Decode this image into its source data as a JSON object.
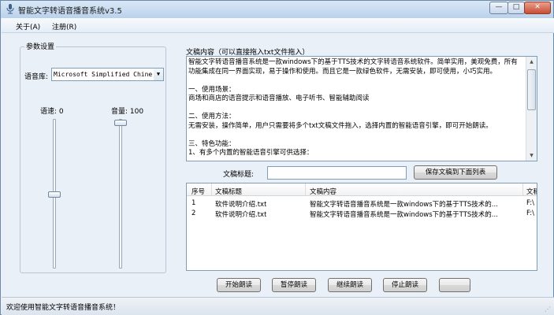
{
  "window": {
    "title": "智能文字转语音播音系统v3.5",
    "min_glyph": "—",
    "max_glyph": "□",
    "close_glyph": "✕"
  },
  "menu": {
    "about": "关于(A)",
    "register": "注册(R)"
  },
  "params": {
    "group_label": "参数设置",
    "voice_label": "语音库:",
    "voice_value": "Microsoft Simplified Chine",
    "rate_label": "语速: 0",
    "volume_label": "音量: 100",
    "rate_value": 0,
    "volume_value": 100
  },
  "content": {
    "label": "文稿内容（可以直接拖入txt文件拖入）",
    "text": "智能文字转语音播音系统是一款windows下的基于TTS技术的文字转语音系统软件。简单实用，美观免费，所有功能集成在同一界面实现，易于操作和使用。而且它是一款绿色软件，无需安装，即可使用，小巧实用。\n\n一、使用场景：\n商场和商店的语音提示和语音播放、电子听书、智能辅助阅读\n\n二、使用方法：\n无需安装，操作简单，用户只需要将多个txt文稿文件拖入，选择内置的智能语音引擎，即可开始朗读。\n\n三、特色功能：\n1、有多个内置的智能语音引擎可供选择："
  },
  "doc_title": {
    "label": "文稿标题:",
    "value": "",
    "save_button": "保存文稿到下面列表"
  },
  "table": {
    "headers": [
      "序号",
      "文稿标题",
      "文稿内容",
      "文稿"
    ],
    "rows": [
      [
        "1",
        "软件说明介绍.txt",
        "智能文字转语音播音系统是一款windows下的基于TTS技术的...",
        "F:\\"
      ],
      [
        "2",
        "软件说明介绍.txt",
        "智能文字转语音播音系统是一款windows下的基于TTS技术的...",
        "F:\\"
      ]
    ]
  },
  "buttons": {
    "start": "开始朗读",
    "pause": "暂停朗读",
    "resume": "继续朗读",
    "stop": "停止朗读",
    "extra": ""
  },
  "status": {
    "text": "欢迎使用智能文字转语音播音系统！"
  },
  "icons": {
    "app": "microphone-icon",
    "dropdown": "chevron-down-icon",
    "scroll_up": "triangle-up-icon",
    "scroll_down": "triangle-down-icon"
  },
  "colors": {
    "titlebar": "#bcd3ec",
    "close": "#c84e34",
    "window_bg": "#eaf0f7"
  }
}
